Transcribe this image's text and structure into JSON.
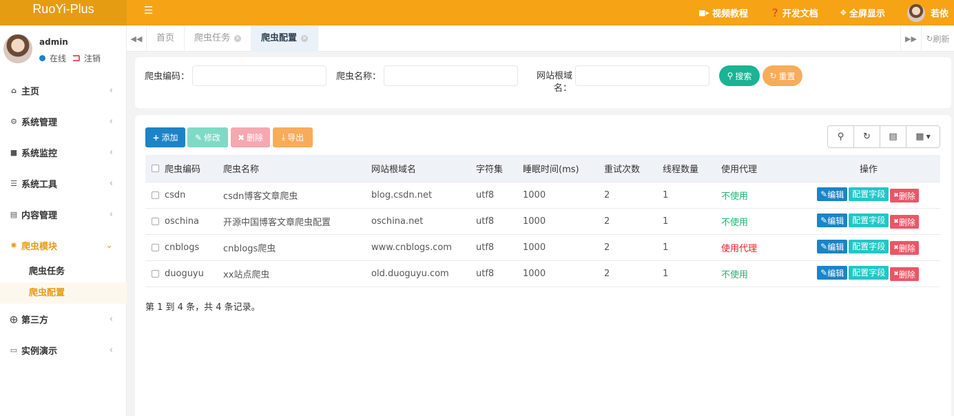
{
  "app": {
    "logo": "RuoYi-Plus"
  },
  "header": {
    "links": [
      {
        "icon": "video-icon",
        "label": "视频教程"
      },
      {
        "icon": "question-icon",
        "label": "开发文档"
      },
      {
        "icon": "fullscreen-icon",
        "label": "全屏显示"
      }
    ],
    "user_name": "若依"
  },
  "profile": {
    "name": "admin",
    "online": "在线",
    "logout": "注销"
  },
  "sidebar": {
    "items": [
      {
        "icon": "home-icon",
        "label": "主页"
      },
      {
        "icon": "gear-icon",
        "label": "系统管理"
      },
      {
        "icon": "video-icon",
        "label": "系统监控"
      },
      {
        "icon": "bars-icon",
        "label": "系统工具"
      },
      {
        "icon": "content-icon",
        "label": "内容管理"
      },
      {
        "icon": "spider-icon",
        "label": "爬虫模块",
        "expanded": true,
        "children": [
          {
            "label": "爬虫任务"
          },
          {
            "label": "爬虫配置",
            "current": true
          }
        ]
      },
      {
        "icon": "support-icon",
        "label": "第三方"
      },
      {
        "icon": "desktop-icon",
        "label": "实例演示"
      }
    ]
  },
  "tabs": {
    "items": [
      {
        "label": "首页",
        "closable": false
      },
      {
        "label": "爬虫任务",
        "closable": true
      },
      {
        "label": "爬虫配置",
        "closable": true,
        "active": true
      }
    ],
    "refresh_label": "刷新"
  },
  "search": {
    "code_label": "爬虫编码：",
    "name_label": "爬虫名称：",
    "domain_label_line1": "网站根域",
    "domain_label_line2": "名：",
    "search_button": "搜索",
    "reset_button": "重置"
  },
  "toolbar": {
    "add": "添加",
    "edit": "修改",
    "delete": "删除",
    "export": "导出"
  },
  "table": {
    "columns": [
      "爬虫编码",
      "爬虫名称",
      "网站根域名",
      "字符集",
      "睡眠时间(ms)",
      "重试次数",
      "线程数量",
      "使用代理",
      "操作"
    ],
    "rows": [
      {
        "code": "csdn",
        "name": "csdn博客文章爬虫",
        "domain": "blog.csdn.net",
        "charset": "utf8",
        "sleep": "1000",
        "retry": "2",
        "threads": "1",
        "proxy": "不使用",
        "proxy_on": false
      },
      {
        "code": "oschina",
        "name": "开源中国博客文章爬虫配置",
        "domain": "oschina.net",
        "charset": "utf8",
        "sleep": "1000",
        "retry": "2",
        "threads": "1",
        "proxy": "不使用",
        "proxy_on": false
      },
      {
        "code": "cnblogs",
        "name": "cnblogs爬虫",
        "domain": "www.cnblogs.com",
        "charset": "utf8",
        "sleep": "1000",
        "retry": "2",
        "threads": "1",
        "proxy": "使用代理",
        "proxy_on": true
      },
      {
        "code": "duoguyu",
        "name": "xx站点爬虫",
        "domain": "old.duoguyu.com",
        "charset": "utf8",
        "sleep": "1000",
        "retry": "2",
        "threads": "1",
        "proxy": "不使用",
        "proxy_on": false
      }
    ],
    "row_actions": {
      "edit": "编辑",
      "fields": "配置字段",
      "delete": "删除"
    },
    "footer": "第 1 到 4 条，共 4 条记录。"
  },
  "colors": {
    "brand": "#f6a316",
    "logo_bg": "#e69c12",
    "primary": "#1c84c6",
    "success": "#1ab394",
    "info": "#23c6c8",
    "danger": "#ed5565",
    "warning": "#f8ac59"
  }
}
